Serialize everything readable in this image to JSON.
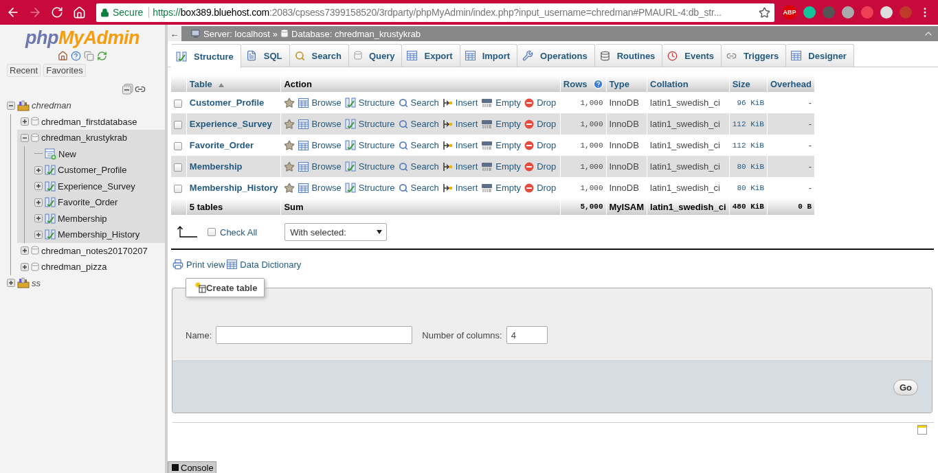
{
  "browser": {
    "secure_label": "Secure",
    "url": {
      "scheme": "https://",
      "host": "box389.bluehost.com",
      "path": ":2083/cpsess7399158520/3rdparty/phpMyAdmin/index.php?input_username=chredman#PMAURL-4:db_str..."
    },
    "extension_badge": "ABP"
  },
  "sidebar": {
    "logo": {
      "left": "php",
      "right": "MyAdmin"
    },
    "buttons": [
      "Recent",
      "Favorites"
    ],
    "tree": [
      {
        "label": "chredman",
        "kind": "server",
        "expanded": true,
        "children": [
          {
            "label": "chredman_firstdatabase",
            "kind": "database",
            "expanded": false,
            "selected": false
          },
          {
            "label": "chredman_krustykrab",
            "kind": "database",
            "expanded": true,
            "selected": true,
            "children": [
              {
                "label": "New",
                "kind": "new"
              },
              {
                "label": "Customer_Profile",
                "kind": "table",
                "expanded": false
              },
              {
                "label": "Experience_Survey",
                "kind": "table",
                "expanded": false
              },
              {
                "label": "Favorite_Order",
                "kind": "table",
                "expanded": false
              },
              {
                "label": "Membership",
                "kind": "table",
                "expanded": false
              },
              {
                "label": "Membership_History",
                "kind": "table",
                "expanded": false
              }
            ]
          },
          {
            "label": "chredman_notes20170207",
            "kind": "database",
            "expanded": false,
            "selected": false
          },
          {
            "label": "chredman_pizza",
            "kind": "database",
            "expanded": false,
            "selected": false
          }
        ]
      },
      {
        "label": "ss",
        "kind": "server",
        "expanded": false
      }
    ]
  },
  "breadcrumb": {
    "back": "←",
    "server": "Server: localhost",
    "separator": "»",
    "database": "Database: chredman_krustykrab"
  },
  "tabs": [
    {
      "label": "Structure",
      "selected": true
    },
    {
      "label": "SQL",
      "selected": false
    },
    {
      "label": "Search",
      "selected": false
    },
    {
      "label": "Query",
      "selected": false
    },
    {
      "label": "Export",
      "selected": false
    },
    {
      "label": "Import",
      "selected": false
    },
    {
      "label": "Operations",
      "selected": false
    },
    {
      "label": "Routines",
      "selected": false
    },
    {
      "label": "Events",
      "selected": false
    },
    {
      "label": "Triggers",
      "selected": false
    },
    {
      "label": "Designer",
      "selected": false
    }
  ],
  "table": {
    "columns": [
      "Table",
      "Action",
      "Rows",
      "Type",
      "Collation",
      "Size",
      "Overhead"
    ],
    "rows": [
      {
        "name": "Customer_Profile",
        "checked": false,
        "actions": [
          {
            "kind": "browse",
            "label": "Browse"
          },
          {
            "kind": "structure",
            "label": "Structure"
          },
          {
            "kind": "search",
            "label": "Search"
          },
          {
            "kind": "insert",
            "label": "Insert"
          },
          {
            "kind": "empty",
            "label": "Empty"
          },
          {
            "kind": "drop",
            "label": "Drop"
          }
        ],
        "rows": "1,000",
        "type": "InnoDB",
        "collation": "latin1_swedish_ci",
        "size": "96 KiB",
        "overhead": "-"
      },
      {
        "name": "Experience_Survey",
        "checked": false,
        "actions": [
          {
            "kind": "browse",
            "label": "Browse"
          },
          {
            "kind": "structure",
            "label": "Structure"
          },
          {
            "kind": "search",
            "label": "Search"
          },
          {
            "kind": "insert",
            "label": "Insert"
          },
          {
            "kind": "empty",
            "label": "Empty"
          },
          {
            "kind": "drop",
            "label": "Drop"
          }
        ],
        "rows": "1,000",
        "type": "InnoDB",
        "collation": "latin1_swedish_ci",
        "size": "112 KiB",
        "overhead": "-"
      },
      {
        "name": "Favorite_Order",
        "checked": false,
        "actions": [
          {
            "kind": "browse",
            "label": "Browse"
          },
          {
            "kind": "structure",
            "label": "Structure"
          },
          {
            "kind": "search",
            "label": "Search"
          },
          {
            "kind": "insert",
            "label": "Insert"
          },
          {
            "kind": "empty",
            "label": "Empty"
          },
          {
            "kind": "drop",
            "label": "Drop"
          }
        ],
        "rows": "1,000",
        "type": "InnoDB",
        "collation": "latin1_swedish_ci",
        "size": "112 KiB",
        "overhead": "-"
      },
      {
        "name": "Membership",
        "checked": false,
        "actions": [
          {
            "kind": "browse",
            "label": "Browse"
          },
          {
            "kind": "structure",
            "label": "Structure"
          },
          {
            "kind": "search",
            "label": "Search"
          },
          {
            "kind": "insert",
            "label": "Insert"
          },
          {
            "kind": "empty",
            "label": "Empty"
          },
          {
            "kind": "drop",
            "label": "Drop"
          }
        ],
        "rows": "1,000",
        "type": "InnoDB",
        "collation": "latin1_swedish_ci",
        "size": "80 KiB",
        "overhead": "-"
      },
      {
        "name": "Membership_History",
        "checked": false,
        "actions": [
          {
            "kind": "browse",
            "label": "Browse"
          },
          {
            "kind": "structure",
            "label": "Structure"
          },
          {
            "kind": "search",
            "label": "Search"
          },
          {
            "kind": "insert",
            "label": "Insert"
          },
          {
            "kind": "empty",
            "label": "Empty"
          },
          {
            "kind": "drop",
            "label": "Drop"
          }
        ],
        "rows": "1,000",
        "type": "InnoDB",
        "collation": "latin1_swedish_ci",
        "size": "80 KiB",
        "overhead": "-"
      }
    ],
    "footer": {
      "count": "5 tables",
      "action": "Sum",
      "rows": "5,000",
      "type": "MyISAM",
      "collation": "latin1_swedish_ci",
      "size": "480 KiB",
      "overhead": "0 B"
    }
  },
  "bulk": {
    "check_all": "Check All",
    "checked": false,
    "with_selected": "With selected:"
  },
  "links": [
    {
      "kind": "print",
      "label": "Print view"
    },
    {
      "kind": "dictionary",
      "label": "Data Dictionary"
    }
  ],
  "create": {
    "legend": "Create table",
    "name_label": "Name:",
    "columns_label": "Number of columns:",
    "columns_value": "4",
    "go": "Go"
  },
  "console": "Console"
}
